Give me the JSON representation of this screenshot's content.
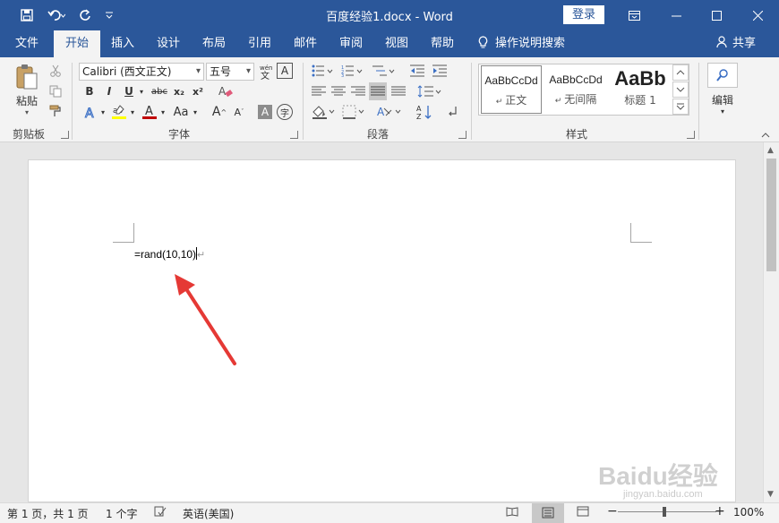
{
  "titlebar": {
    "document_title": "百度经验1.docx - Word",
    "login_label": "登录"
  },
  "tabs": [
    {
      "label": "文件"
    },
    {
      "label": "开始"
    },
    {
      "label": "插入"
    },
    {
      "label": "设计"
    },
    {
      "label": "布局"
    },
    {
      "label": "引用"
    },
    {
      "label": "邮件"
    },
    {
      "label": "审阅"
    },
    {
      "label": "视图"
    },
    {
      "label": "帮助"
    }
  ],
  "tell_me": "操作说明搜索",
  "share": "共享",
  "ribbon": {
    "clipboard": {
      "paste_label": "粘贴",
      "group_label": "剪贴板"
    },
    "font": {
      "font_name": "Calibri (西文正文)",
      "font_size": "五号",
      "bold": "B",
      "italic": "I",
      "underline": "U",
      "strikethrough": "abc",
      "subscript": "x₂",
      "superscript": "x²",
      "change_case": "Aa",
      "grow": "A",
      "shrink": "A",
      "group_label": "字体"
    },
    "paragraph": {
      "group_label": "段落"
    },
    "styles": {
      "items": [
        {
          "sample": "AaBbCcDd",
          "name": "正文"
        },
        {
          "sample": "AaBbCcDd",
          "name": "无间隔"
        },
        {
          "sample": "AaBb",
          "name": "标题 1"
        }
      ],
      "group_label": "样式"
    },
    "editing": {
      "label": "编辑"
    }
  },
  "document": {
    "text": "=rand(10,10)"
  },
  "statusbar": {
    "page": "第 1 页，共 1 页",
    "words": "1 个字",
    "language": "英语(美国)",
    "zoom": "100%",
    "zoom_percent": 100
  },
  "watermark": {
    "brand": "Baidu经验",
    "url": "jingyan.baidu.com"
  },
  "colors": {
    "accent": "#2b579a",
    "highlight": "#ffff00",
    "font_color": "#c00000",
    "annotation_arrow": "#e53935"
  }
}
